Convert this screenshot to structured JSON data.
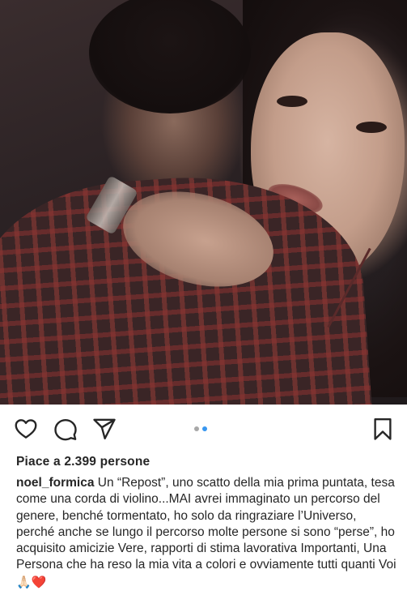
{
  "post": {
    "image": {
      "description_icon": "photo-couple-selfie"
    },
    "actions": {
      "like_icon": "heart-outline-icon",
      "comment_icon": "comment-bubble-icon",
      "share_icon": "paper-plane-icon",
      "save_icon": "bookmark-outline-icon"
    },
    "carousel": {
      "total": 2,
      "active_index": 1,
      "active_color": "#3897f0",
      "inactive_color": "#a8a8a8"
    },
    "likes_text": "Piace a 2.399 persone",
    "caption": {
      "username": "noel_formica",
      "text": " Un “Repost”, uno scatto della mia prima puntata, tesa come una corda di violino...MAI avrei immaginato un percorso del genere, benché tormentato, ho solo da ringraziare l’Universo, perché anche se lungo il percorso molte persone si sono “perse”, ho acquisito amicizie Vere, rapporti di stima lavorativa Importanti, Una Persona che ha reso la mia vita a colori e ovviamente tutti quanti Voi ",
      "emoji_hands": "🙏🏻",
      "emoji_heart": "❤️"
    }
  }
}
